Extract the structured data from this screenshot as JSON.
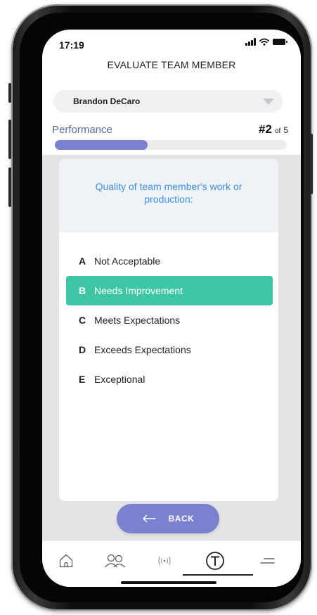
{
  "status_bar": {
    "time": "17:19"
  },
  "header": {
    "title": "EVALUATE TEAM MEMBER"
  },
  "member_select": {
    "selected": "Brandon DeCaro"
  },
  "progress": {
    "section": "Performance",
    "current": "#2",
    "of_label": "of",
    "total": "5",
    "fill_fraction": 0.4
  },
  "question": {
    "text": "Quality of team member's work or production:",
    "options": [
      {
        "letter": "A",
        "label": "Not Acceptable",
        "selected": false
      },
      {
        "letter": "B",
        "label": "Needs Improvement",
        "selected": true
      },
      {
        "letter": "C",
        "label": "Meets Expectations",
        "selected": false
      },
      {
        "letter": "D",
        "label": "Exceeds Expectations",
        "selected": false
      },
      {
        "letter": "E",
        "label": "Exceptional",
        "selected": false
      }
    ]
  },
  "back_button": {
    "label": "BACK"
  },
  "tab_bar": {
    "tabs": [
      {
        "icon": "home-icon"
      },
      {
        "icon": "team-icon"
      },
      {
        "icon": "broadcast-icon"
      },
      {
        "icon": "t-logo-icon"
      },
      {
        "icon": "menu-icon"
      }
    ]
  },
  "colors": {
    "accent": "#7b80cf",
    "selected_option": "#3ec5a3",
    "question_text": "#3d8fe0",
    "section_label": "#5b6b9a"
  }
}
